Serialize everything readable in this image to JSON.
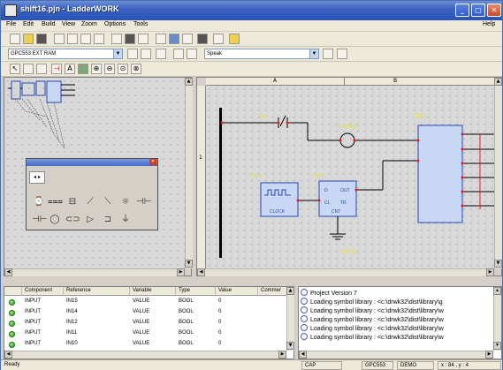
{
  "window": {
    "title": "shift16.pjn - LadderWORK"
  },
  "menu": {
    "items": [
      "File",
      "Edit",
      "Build",
      "View",
      "Zoom",
      "Options",
      "Tools"
    ],
    "help": "Help"
  },
  "toolbar2": {
    "device_combo": "GPC553 EXT RAM",
    "speed_combo": "Speak"
  },
  "ladder": {
    "columns": [
      "A",
      "B"
    ],
    "row_label": "1",
    "labels": {
      "contact": "SS1",
      "coil": "ENABLE",
      "clock": "CLK1",
      "counter": "CNT1",
      "drum": "DRC1",
      "counter_comp": "CNT",
      "clock_text": "CLOCK",
      "pin_d": "D",
      "pin_cl": "CL",
      "pin_out": "OUT",
      "pin_tr": "TR",
      "bottom_label": "GRAIN"
    }
  },
  "table": {
    "headers": [
      "",
      "Component",
      "Reference",
      "Variable",
      "Type",
      "Value",
      "Commer"
    ],
    "rows": [
      {
        "component": "INPUT",
        "reference": "IN15",
        "variable": "VALUE",
        "type": "BOOL",
        "value": "0"
      },
      {
        "component": "INPUT",
        "reference": "IN14",
        "variable": "VALUE",
        "type": "BOOL",
        "value": "0"
      },
      {
        "component": "INPUT",
        "reference": "IN12",
        "variable": "VALUE",
        "type": "BOOL",
        "value": "0"
      },
      {
        "component": "INPUT",
        "reference": "IN11",
        "variable": "VALUE",
        "type": "BOOL",
        "value": "0"
      },
      {
        "component": "INPUT",
        "reference": "IN10",
        "variable": "VALUE",
        "type": "BOOL",
        "value": "0"
      }
    ]
  },
  "output": {
    "lines": [
      "Project Version 7",
      "Loading symbol library : <c:\\drwk32\\dist\\library\\g",
      "Loading symbol library : <c:\\drwk32\\dist\\library\\w",
      "Loading symbol library : <c:\\drwk32\\dist\\library\\w",
      "Loading symbol library : <c:\\drwk32\\dist\\library\\w",
      "Loading symbol library : <c:\\drwk32\\dist\\library\\w"
    ]
  },
  "status": {
    "ready": "Ready",
    "cap": "CAP",
    "device": "GPC553",
    "mode": "DEMO",
    "coords": "x : 84 , y : 4"
  },
  "colors": {
    "titlebar": "#2a53b8",
    "wire_red": "#e02020",
    "label_yellow": "#e8e060",
    "block_border": "#2a48b0",
    "block_fill": "#c8d8f4",
    "status_green": "#1f9a12"
  }
}
